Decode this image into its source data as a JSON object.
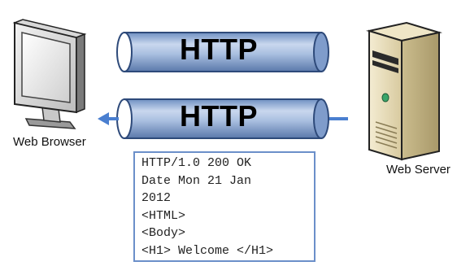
{
  "client": {
    "label": "Web Browser",
    "icon": "monitor-icon"
  },
  "server": {
    "label": "Web Server",
    "icon": "server-tower-icon"
  },
  "request_pipe": {
    "label": "HTTP"
  },
  "response_pipe": {
    "label": "HTTP"
  },
  "response": {
    "lines": [
      "HTTP/1.0 200 OK",
      "Date Mon 21 Jan",
      "2012",
      "<HTML>",
      "<Body>",
      "<H1> Welcome </H1>"
    ]
  },
  "colors": {
    "pipe_fill": "#9fb6d8",
    "pipe_edge": "#2e4a7a",
    "arrow": "#4a7fd0",
    "box_border": "#6b8fc9"
  }
}
